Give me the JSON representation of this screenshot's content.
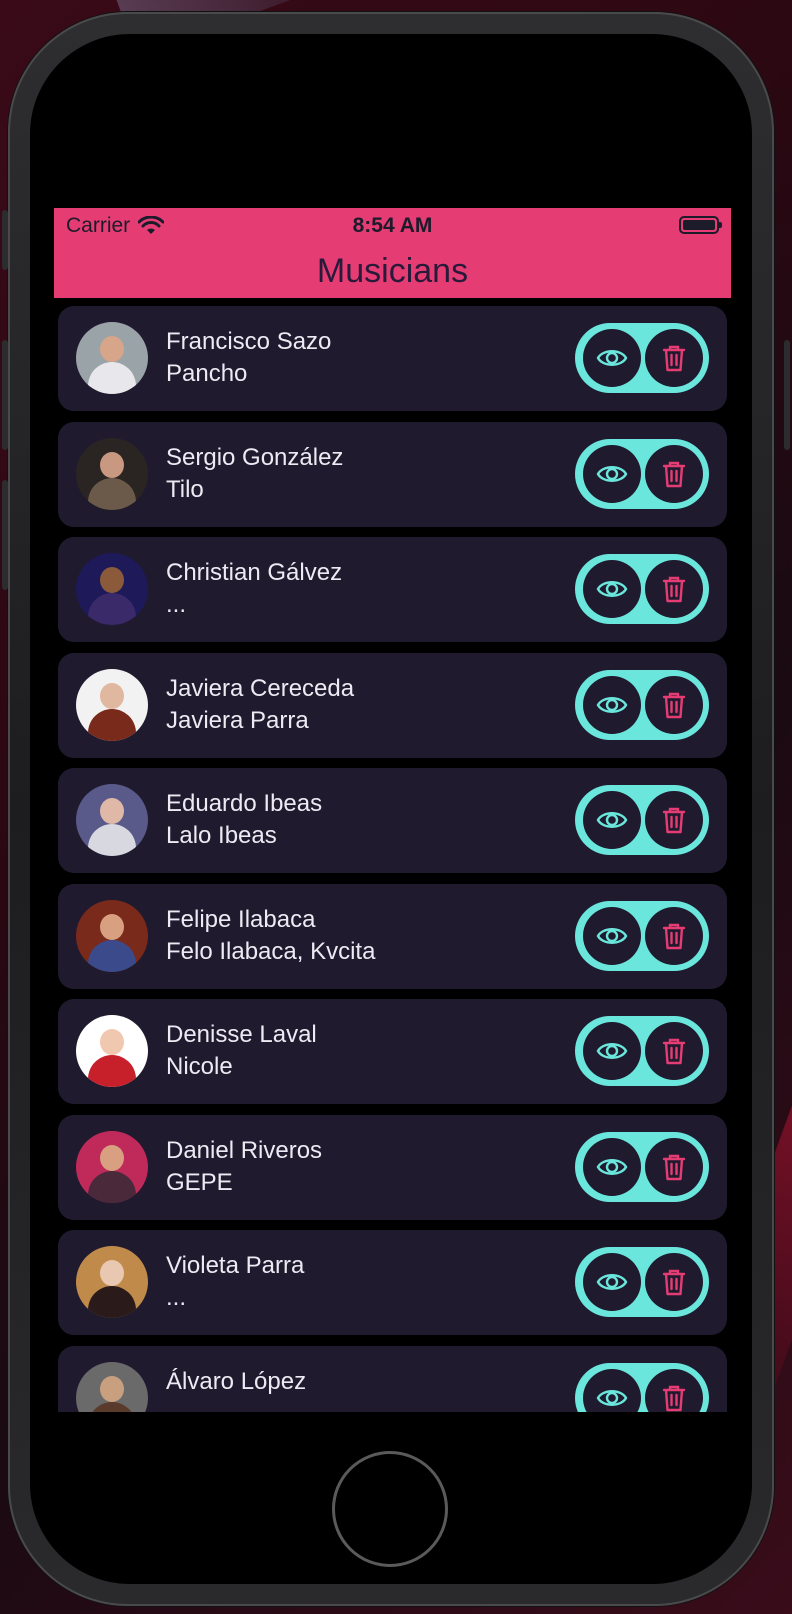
{
  "status_bar": {
    "carrier": "Carrier",
    "time": "8:54 AM"
  },
  "nav": {
    "title": "Musicians"
  },
  "colors": {
    "accent": "#e63c74",
    "action_pill": "#6be6dc",
    "row_background": "#1f1a2e",
    "view_icon": "#6be6dc",
    "delete_icon": "#e63c74"
  },
  "musicians": [
    {
      "name": "Francisco Sazo",
      "alias": "Pancho",
      "avatar": {
        "bg": "#9aa3a8",
        "skin": "#d6a58a",
        "cloth": "#e8e8ec"
      }
    },
    {
      "name": "Sergio González",
      "alias": "Tilo",
      "avatar": {
        "bg": "#2a2522",
        "skin": "#c89880",
        "cloth": "#6b5a4a"
      }
    },
    {
      "name": "Christian Gálvez",
      "alias": "...",
      "avatar": {
        "bg": "#1e1a5a",
        "skin": "#8a5a3a",
        "cloth": "#3a2a6a"
      }
    },
    {
      "name": "Javiera Cereceda",
      "alias": "Javiera Parra",
      "avatar": {
        "bg": "#f2f2f2",
        "skin": "#e0b8a0",
        "cloth": "#7a2a1a"
      }
    },
    {
      "name": "Eduardo Ibeas",
      "alias": "Lalo Ibeas",
      "avatar": {
        "bg": "#5a5a8a",
        "skin": "#e0b8a8",
        "cloth": "#d8d8e0"
      }
    },
    {
      "name": "Felipe Ilabaca",
      "alias": "Felo Ilabaca, Kvcita",
      "avatar": {
        "bg": "#7a2a1a",
        "skin": "#d8a080",
        "cloth": "#3a4a8a"
      }
    },
    {
      "name": "Denisse Laval",
      "alias": "Nicole",
      "avatar": {
        "bg": "#ffffff",
        "skin": "#f0c8b0",
        "cloth": "#c8202a"
      }
    },
    {
      "name": "Daniel Riveros",
      "alias": "GEPE",
      "avatar": {
        "bg": "#c02a5a",
        "skin": "#d8a080",
        "cloth": "#4a2a3a"
      }
    },
    {
      "name": "Violeta Parra",
      "alias": "...",
      "avatar": {
        "bg": "#c08a4a",
        "skin": "#e8c8b0",
        "cloth": "#2a1a1a"
      }
    },
    {
      "name": "Álvaro  López",
      "alias": "",
      "avatar": {
        "bg": "#6a6a6a",
        "skin": "#c8a080",
        "cloth": "#5a3a2a"
      }
    }
  ],
  "icons": {
    "view": "eye-icon",
    "delete": "trash-icon"
  }
}
